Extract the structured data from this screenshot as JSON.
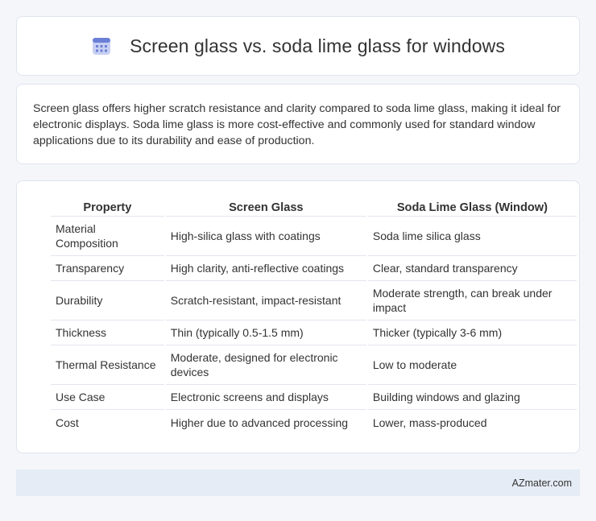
{
  "header": {
    "title": "Screen glass vs. soda lime glass for windows",
    "icon": "calendar-icon"
  },
  "summary": {
    "text": "Screen glass offers higher scratch resistance and clarity compared to soda lime glass, making it ideal for electronic displays. Soda lime glass is more cost-effective and commonly used for standard window applications due to its durability and ease of production."
  },
  "table": {
    "headers": [
      "Property",
      "Screen Glass",
      "Soda Lime Glass (Window)"
    ],
    "rows": [
      [
        "Material Composition",
        "High-silica glass with coatings",
        "Soda lime silica glass"
      ],
      [
        "Transparency",
        "High clarity, anti-reflective coatings",
        "Clear, standard transparency"
      ],
      [
        "Durability",
        "Scratch-resistant, impact-resistant",
        "Moderate strength, can break under impact"
      ],
      [
        "Thickness",
        "Thin (typically 0.5-1.5 mm)",
        "Thicker (typically 3-6 mm)"
      ],
      [
        "Thermal Resistance",
        "Moderate, designed for electronic devices",
        "Low to moderate"
      ],
      [
        "Use Case",
        "Electronic screens and displays",
        "Building windows and glazing"
      ],
      [
        "Cost",
        "Higher due to advanced processing",
        "Lower, mass-produced"
      ]
    ]
  },
  "footer": {
    "text": "AZmater.com"
  },
  "colors": {
    "background": "#f4f6fa",
    "card": "#ffffff",
    "footer": "#e6ecf5",
    "icon_accent": "#6b7fd7"
  }
}
